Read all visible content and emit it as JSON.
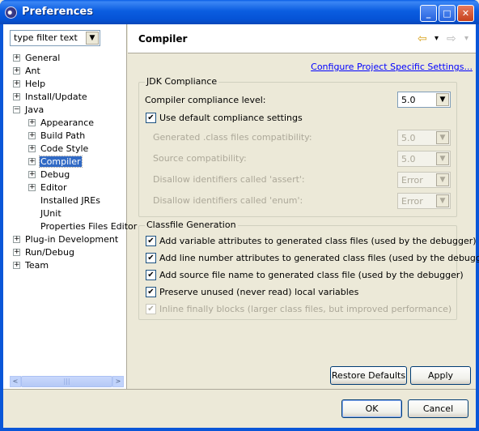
{
  "window": {
    "title": "Preferences",
    "min": "_",
    "max": "□",
    "close": "✕"
  },
  "filter": {
    "text": "type filter text",
    "arrow": "▼"
  },
  "tree": [
    {
      "label": "General",
      "exp": "+"
    },
    {
      "label": "Ant",
      "exp": "+"
    },
    {
      "label": "Help",
      "exp": "+"
    },
    {
      "label": "Install/Update",
      "exp": "+"
    },
    {
      "label": "Java",
      "exp": "−"
    },
    {
      "label": "Appearance",
      "exp": "+"
    },
    {
      "label": "Build Path",
      "exp": "+"
    },
    {
      "label": "Code Style",
      "exp": "+"
    },
    {
      "label": "Compiler",
      "exp": "+"
    },
    {
      "label": "Debug",
      "exp": "+"
    },
    {
      "label": "Editor",
      "exp": "+"
    },
    {
      "label": "Installed JREs",
      "exp": ""
    },
    {
      "label": "JUnit",
      "exp": ""
    },
    {
      "label": "Properties Files Editor",
      "exp": ""
    },
    {
      "label": "Plug-in Development",
      "exp": "+"
    },
    {
      "label": "Run/Debug",
      "exp": "+"
    },
    {
      "label": "Team",
      "exp": "+"
    }
  ],
  "scroll": {
    "left": "<",
    "right": ">",
    "grip": "|||"
  },
  "page": {
    "title": "Compiler",
    "back": "⇦",
    "forward": "⇨",
    "menu": "▾",
    "configure_link": "Configure Project Specific Settings...",
    "jdk": {
      "legend": "JDK Compliance",
      "compliance_label": "Compiler compliance level:",
      "compliance_value": "5.0",
      "use_default": "Use default compliance settings",
      "rows": [
        {
          "label": "Generated .class files compatibility:",
          "value": "5.0"
        },
        {
          "label": "Source compatibility:",
          "value": "5.0"
        },
        {
          "label": "Disallow identifiers called 'assert':",
          "value": "Error"
        },
        {
          "label": "Disallow identifiers called 'enum':",
          "value": "Error"
        }
      ]
    },
    "classfile": {
      "legend": "Classfile Generation",
      "options": [
        "Add variable attributes to generated class files (used by the debugger)",
        "Add line number attributes to generated class files (used by the debugger)",
        "Add source file name to generated class file (used by the debugger)",
        "Preserve unused (never read) local variables",
        "Inline finally blocks (larger class files, but improved performance)"
      ]
    },
    "restore_defaults": "Restore Defaults",
    "apply": "Apply"
  },
  "footer": {
    "ok": "OK",
    "cancel": "Cancel"
  },
  "check": "✔",
  "combo_arrow": "▼"
}
